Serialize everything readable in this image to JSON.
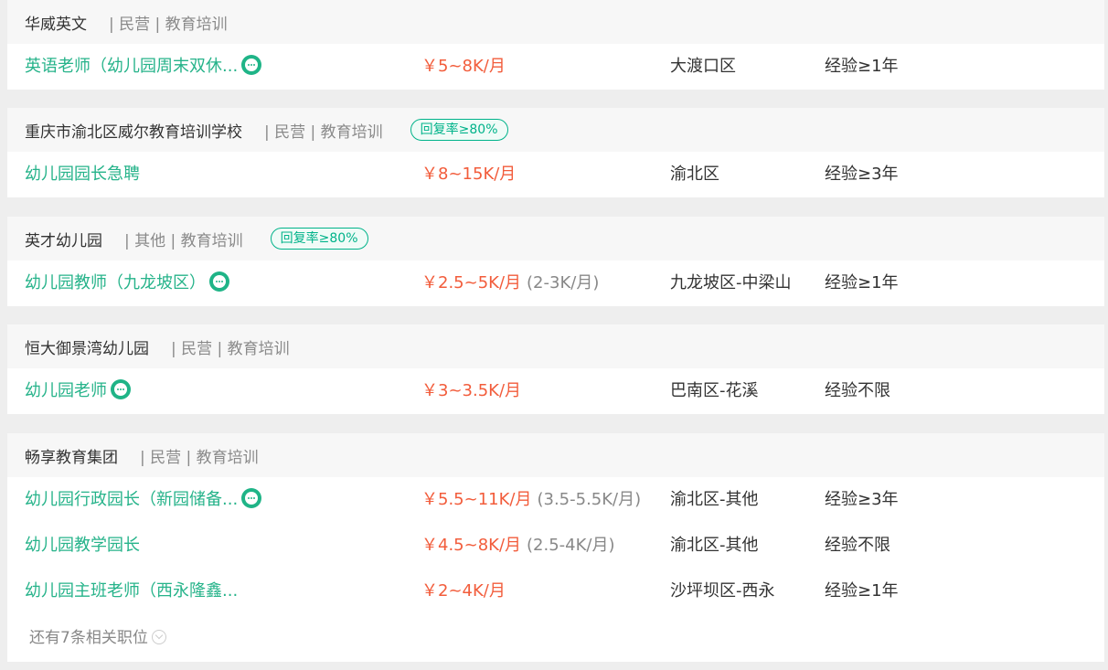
{
  "cards": [
    {
      "company": "华威英文",
      "meta": "| 民营 | 教育培训",
      "badge": "",
      "jobs": [
        {
          "title": "英语老师（幼儿园周末双休...",
          "chat": true,
          "salary": "￥5~8K/月",
          "salary_sub": "",
          "location": "大渡口区",
          "experience": "经验≥1年"
        }
      ]
    },
    {
      "company": "重庆市渝北区威尔教育培训学校",
      "meta": "| 民营 | 教育培训",
      "badge": "回复率≥80%",
      "jobs": [
        {
          "title": "幼儿园园长急聘",
          "chat": false,
          "salary": "￥8~15K/月",
          "salary_sub": "",
          "location": "渝北区",
          "experience": "经验≥3年"
        }
      ]
    },
    {
      "company": "英才幼儿园",
      "meta": "| 其他 | 教育培训",
      "badge": "回复率≥80%",
      "jobs": [
        {
          "title": "幼儿园教师（九龙坡区）",
          "chat": true,
          "salary": "￥2.5~5K/月",
          "salary_sub": "(2-3K/月)",
          "location": "九龙坡区-中梁山",
          "experience": "经验≥1年"
        }
      ]
    },
    {
      "company": "恒大御景湾幼儿园",
      "meta": "| 民营 | 教育培训",
      "badge": "",
      "jobs": [
        {
          "title": "幼儿园老师",
          "chat": true,
          "salary": "￥3~3.5K/月",
          "salary_sub": "",
          "location": "巴南区-花溪",
          "experience": "经验不限"
        }
      ]
    },
    {
      "company": "畅享教育集团",
      "meta": "| 民营 | 教育培训",
      "badge": "",
      "jobs": [
        {
          "title": "幼儿园行政园长（新园储备...",
          "chat": true,
          "salary": "￥5.5~11K/月",
          "salary_sub": "(3.5-5.5K/月)",
          "location": "渝北区-其他",
          "experience": "经验≥3年"
        },
        {
          "title": "幼儿园教学园长",
          "chat": false,
          "salary": "￥4.5~8K/月",
          "salary_sub": "(2.5-4K/月)",
          "location": "渝北区-其他",
          "experience": "经验不限"
        },
        {
          "title": "幼儿园主班老师（西永隆鑫...",
          "chat": false,
          "salary": "￥2~4K/月",
          "salary_sub": "",
          "location": "沙坪坝区-西永",
          "experience": "经验≥1年"
        }
      ],
      "more": "还有7条相关职位"
    }
  ],
  "colors": {
    "accent": "#26b38a",
    "salary": "#f25c3b",
    "badge": "#00b38a"
  }
}
